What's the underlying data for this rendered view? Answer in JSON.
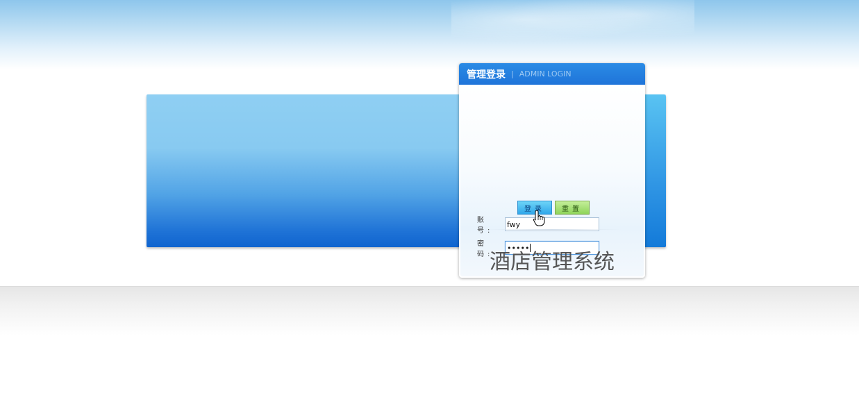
{
  "login": {
    "title": "管理登录",
    "separator": "|",
    "subtitle": "ADMIN LOGIN",
    "account_label": "账 号:",
    "account_value": "fwy",
    "password_label": "密 码:",
    "password_value": "•••••",
    "login_button": "登录",
    "reset_button": "重置"
  },
  "system_title": "酒店管理系统",
  "icons": {
    "cursor": "hand-pointer-icon"
  },
  "colors": {
    "header_blue": "#1f74d9",
    "panel_blue": "#0f64cf",
    "login_btn": "#2fa7ea",
    "reset_btn": "#8fd45a"
  }
}
